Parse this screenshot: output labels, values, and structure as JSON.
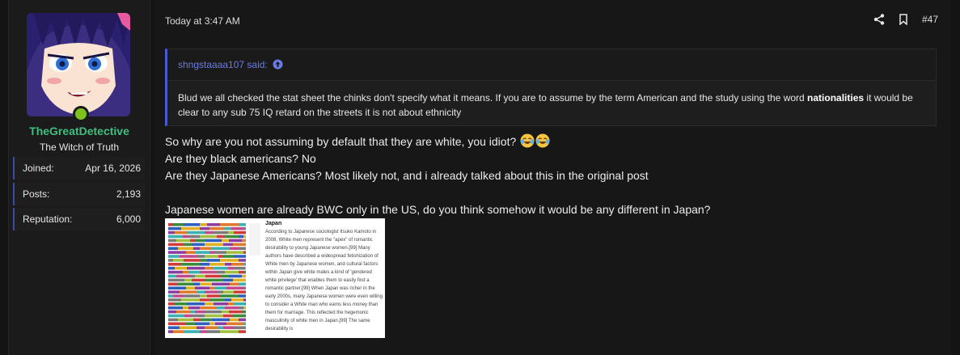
{
  "user": {
    "name": "TheGreatDetective",
    "title": "The Witch of Truth",
    "stats": [
      {
        "key": "Joined:",
        "value": "Apr 16, 2026"
      },
      {
        "key": "Posts:",
        "value": "2,193"
      },
      {
        "key": "Reputation:",
        "value": "6,000"
      }
    ]
  },
  "post": {
    "date": "Today at 3:47 AM",
    "number": "#47",
    "icons": [
      "share-icon",
      "bookmark-icon"
    ]
  },
  "quote": {
    "author_label": "shngstaaaa107 said:",
    "text_before": "Blud we all checked the stat sheet the chinks don't specify what it means. If you are to assume by the term American and the study using the word ",
    "text_bold": "nationalities",
    "text_after": " it would be clear to any sub 75 IQ retard on the streets it is not about ethnicity"
  },
  "message": {
    "lines": [
      "So why are you not assuming by default that they are white, you idiot?",
      "Are they black americans? No",
      "Are they Japanese Americans? Most likely not, and i already talked about this in the original post",
      "",
      "Japanese women are already BWC only in the US, do you think somehow it would be any different in Japan?"
    ],
    "emoji_count": 2
  },
  "attachment": {
    "heading": "Japan",
    "text": "According to Japanese sociologist Itsuko Kamoto in 2008, White men represent the \"apex\" of romantic desirability to young Japanese women.[99] Many authors have described a widespread fetishization of White men by Japanese women, and cultural factors within Japan give white males a kind of 'gendered white privilege' that enables them to easily find a romantic partner.[99] When Japan was richer in the early 2000s, many Japanese women were even willing to consider a White man who earns less money than them for marriage. This reflected the hegemonic masculinity of white men in Japan.[99] The same desirability is"
  },
  "colors": {
    "accent": "#4a5bd2",
    "username": "#3fbf7f",
    "online": "#7cc31c"
  }
}
